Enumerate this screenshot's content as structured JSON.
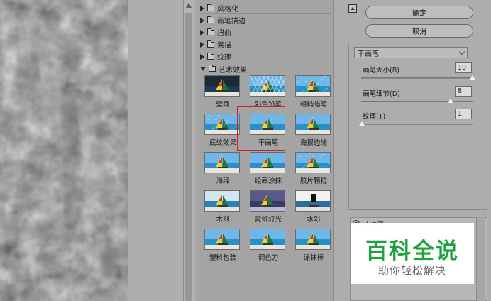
{
  "colors": {
    "selection": "#d42020",
    "watermark_green": "#1ea23d",
    "watermark_gray": "#666666"
  },
  "categories": [
    {
      "label": "风格化",
      "open": false
    },
    {
      "label": "画笔描边",
      "open": false
    },
    {
      "label": "扭曲",
      "open": false
    },
    {
      "label": "素描",
      "open": false
    },
    {
      "label": "纹理",
      "open": false
    },
    {
      "label": "艺术效果",
      "open": true
    }
  ],
  "thumbnails": [
    {
      "label": "壁画"
    },
    {
      "label": "彩色铅笔"
    },
    {
      "label": "粗糙蜡笔"
    },
    {
      "label": "底纹效果"
    },
    {
      "label": "干画笔"
    },
    {
      "label": "海报边缘"
    },
    {
      "label": "海绵"
    },
    {
      "label": "绘画涂抹"
    },
    {
      "label": "胶片颗粒"
    },
    {
      "label": "木刻"
    },
    {
      "label": "霓虹灯光"
    },
    {
      "label": "水彩"
    },
    {
      "label": "塑料包装"
    },
    {
      "label": "调色刀"
    },
    {
      "label": "涂抹棒"
    }
  ],
  "selected_filter": "干画笔",
  "buttons": {
    "ok": "确定",
    "cancel": "取消"
  },
  "settings": {
    "filter_select": "干画笔",
    "params": [
      {
        "label": "画笔大小(B)",
        "value": "10",
        "fraction": 1.0
      },
      {
        "label": "画笔细节(D)",
        "value": "8",
        "fraction": 0.8
      },
      {
        "label": "纹理(T)",
        "value": "1",
        "fraction": 0.0
      }
    ]
  },
  "layers": {
    "row_label": "干画笔"
  },
  "watermark": {
    "title": "百科全说",
    "subtitle": "助你轻松解决"
  }
}
